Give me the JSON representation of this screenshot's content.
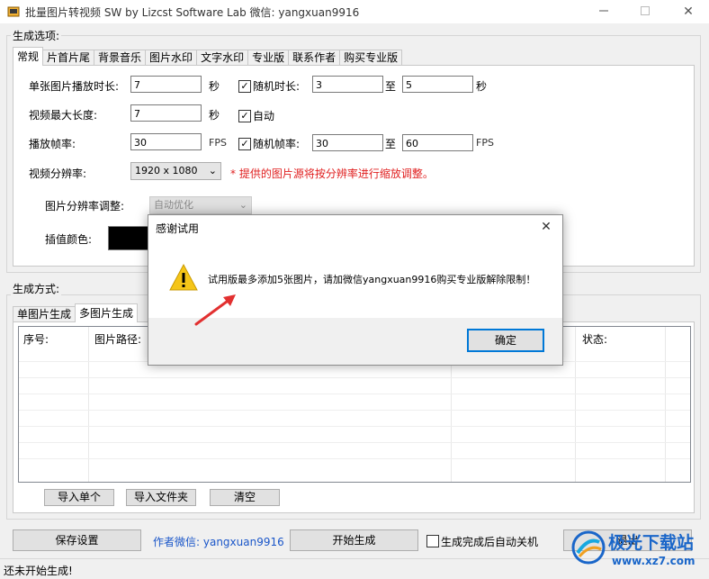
{
  "window": {
    "title": "批量图片转视频 SW  by Lizcst Software Lab  微信: yangxuan9916",
    "min_icon": "minimize-icon",
    "max_icon": "maximize-icon",
    "close_symbol": "✕"
  },
  "options_group": {
    "label": "生成选项:",
    "tabs": [
      "常规",
      "片首片尾",
      "背景音乐",
      "图片水印",
      "文字水印",
      "专业版",
      "联系作者",
      "购买专业版"
    ],
    "active_tab": 0,
    "single_duration_label": "单张图片播放时长:",
    "single_duration_value": "7",
    "sec_unit_1": "秒",
    "random_duration_label": "随机时长:",
    "random_duration_checked": true,
    "random_min": "3",
    "to_1": "至",
    "random_max": "5",
    "sec_unit_2": "秒",
    "max_length_label": "视频最大长度:",
    "max_length_value": "7",
    "sec_unit_3": "秒",
    "auto_label": "自动",
    "auto_checked": true,
    "fps_label": "播放帧率:",
    "fps_value": "30",
    "fps_unit_1": "FPS",
    "random_fps_label": "随机帧率:",
    "random_fps_checked": true,
    "fps_min": "30",
    "to_2": "至",
    "fps_max": "60",
    "fps_unit_2": "FPS",
    "resolution_label": "视频分辨率:",
    "resolution_value": "1920 x 1080",
    "resolution_hint": "* 提供的图片源将按分辨率进行缩放调整。",
    "scale_adjust_label": "图片分辨率调整:",
    "scale_adjust_value": "自动优化",
    "fill_color_label": "插值颜色:",
    "fill_color": "#000000"
  },
  "mode_group": {
    "label": "生成方式:",
    "tabs": [
      "单图片生成",
      "多图片生成"
    ],
    "active_tab": 1,
    "columns": [
      "序号:",
      "图片路径:",
      "状态:"
    ],
    "buttons": [
      "导入单个",
      "导入文件夹",
      "清空"
    ]
  },
  "bottom": {
    "save_button": "保存设置",
    "author_wechat": "作者微信: yangxuan9916",
    "start_button": "开始生成",
    "auto_shutdown_label": "生成完成后自动关机",
    "auto_shutdown_checked": false,
    "exit_button": "退出",
    "status_text": "还未开始生成!"
  },
  "dialog": {
    "title": "感谢试用",
    "message": "试用版最多添加5张图片，请加微信yangxuan9916购买专业版解除限制！",
    "ok_button": "确定",
    "warning_icon": "warning-icon",
    "arrow_icon": "red-arrow-icon",
    "close_symbol": "✕"
  },
  "watermark": {
    "text": "极光下载站",
    "url": "www.xz7.com",
    "logo_icon": "aurora-logo-icon"
  },
  "colors": {
    "accent_blue": "#0066cc",
    "hint_red": "#e02020",
    "warning_yellow": "#f5c518",
    "arrow_red": "#e23030"
  }
}
